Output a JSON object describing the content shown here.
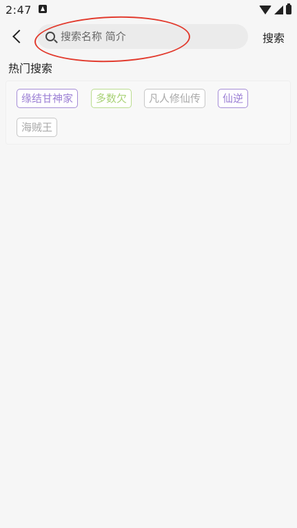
{
  "status_bar": {
    "time": "2:47",
    "icons": [
      "app-notification-icon",
      "wifi-icon",
      "signal-icon",
      "battery-icon"
    ]
  },
  "header": {
    "back_icon": "chevron-left-icon",
    "search_placeholder": "搜索名称 简介",
    "search_value": "",
    "search_button_label": "搜索"
  },
  "hot_search": {
    "title": "热门搜索",
    "tags": [
      {
        "label": "缘结甘神家",
        "color": "#9b7fd4"
      },
      {
        "label": "多数欠",
        "color": "#a9d277"
      },
      {
        "label": "凡人修仙传",
        "color": "#a9a9a9"
      },
      {
        "label": "仙逆",
        "color": "#9b7fd4"
      },
      {
        "label": "海贼王",
        "color": "#a9a9a9"
      }
    ]
  },
  "colors": {
    "background": "#f6f6f6",
    "search_box": "#ebebeb",
    "annotation_red": "#e23b2e"
  }
}
